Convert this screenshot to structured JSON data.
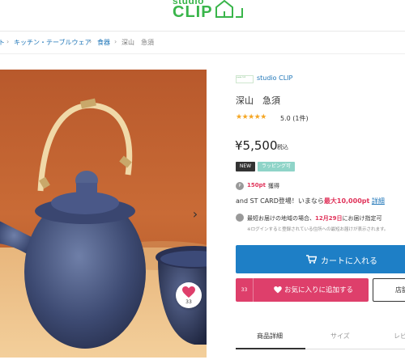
{
  "header": {
    "logo_line1": "studio",
    "logo_line2": "CLIP",
    "brand_color": "#39b54a"
  },
  "breadcrumb": {
    "items": [
      {
        "label": "ト"
      },
      {
        "label": "キッチン・テーブルウェア"
      },
      {
        "label": "食器"
      },
      {
        "label": "深山　急須"
      }
    ],
    "separator": "›"
  },
  "gallery": {
    "next_icon": "chevron-right-icon",
    "favorite_count": "33"
  },
  "product": {
    "shop_logo_text": "studio CLIP",
    "shop_name": "studio CLIP",
    "title": "深山　急須",
    "rating_stars": "★★★★★",
    "rating_score": "5.0 (1件)",
    "price": "¥5,500",
    "price_tax": "税込",
    "badges": {
      "new": "NEW",
      "wrapping": "ラッピング可"
    },
    "points": {
      "icon": "P",
      "value": "150pt",
      "label": "獲得"
    },
    "card_promo": {
      "prefix": "and ST CARD登場！いまなら",
      "highlight": "最大10,000pt",
      "link": "詳細"
    },
    "delivery": {
      "prefix": "最短お届けの地域の場合、",
      "date": "12月29日",
      "suffix": "にお届け指定可"
    },
    "login_note": "※ログインすると登録されている住所への最短お届けが表示されます。"
  },
  "actions": {
    "cart_label": "カートに入れる",
    "favorite_count": "33",
    "favorite_label": "お気に入りに追加する",
    "shop_label": "店舗"
  },
  "tabs": [
    {
      "label": "商品詳細"
    },
    {
      "label": "サイズ"
    },
    {
      "label": "レビュー"
    }
  ],
  "colors": {
    "accent_blue": "#1e7fc6",
    "favorite_pink": "#de3f6b",
    "highlight_red": "#e0335a",
    "star_orange": "#f5a623"
  }
}
